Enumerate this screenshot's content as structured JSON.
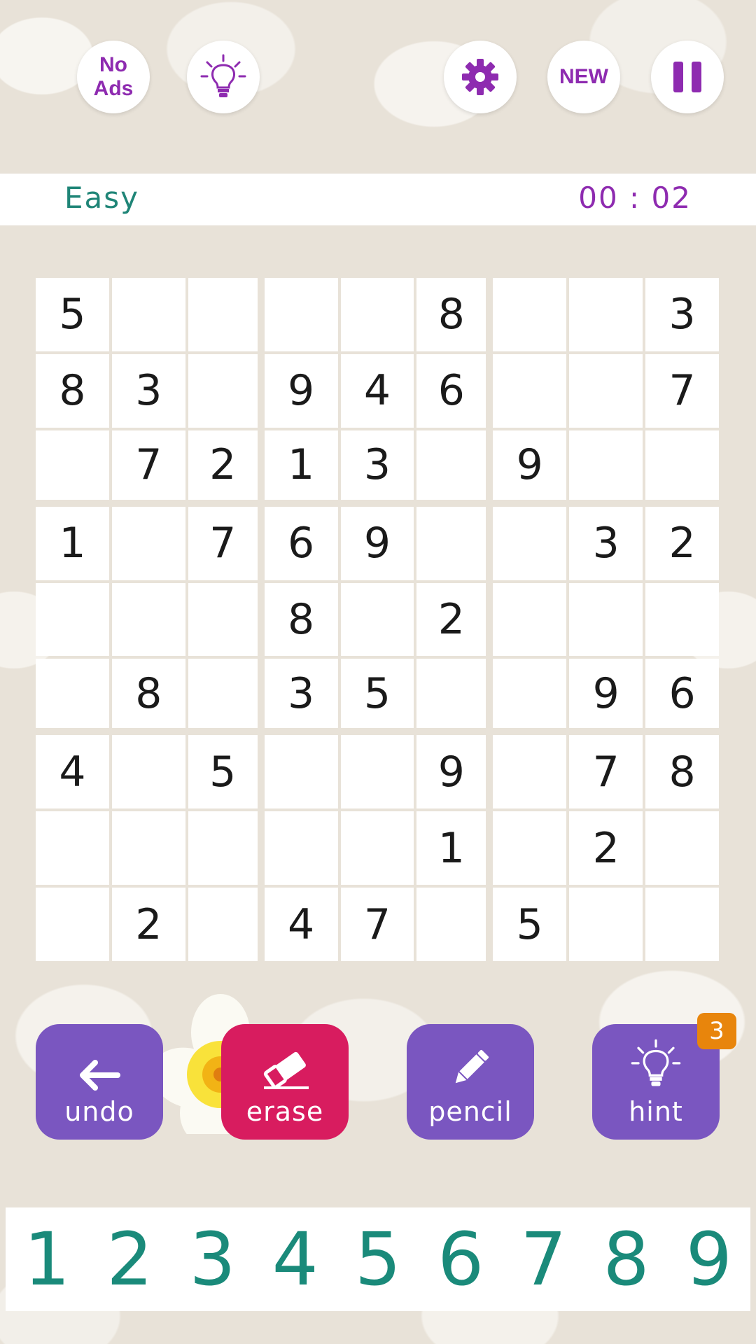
{
  "topbar": {
    "no_ads_line1": "No",
    "no_ads_line2": "Ads",
    "new_label": "NEW",
    "icons": [
      "lightbulb-icon",
      "gear-icon",
      "pause-icon"
    ]
  },
  "status": {
    "difficulty": "Easy",
    "timer": "00 : 02"
  },
  "board": {
    "rows": [
      [
        "5",
        "",
        "",
        "",
        "",
        "8",
        "",
        "",
        "3"
      ],
      [
        "8",
        "3",
        "",
        "9",
        "4",
        "6",
        "",
        "",
        "7"
      ],
      [
        "",
        "7",
        "2",
        "1",
        "3",
        "",
        "9",
        "",
        ""
      ],
      [
        "1",
        "",
        "7",
        "6",
        "9",
        "",
        "",
        "3",
        "2"
      ],
      [
        "",
        "",
        "",
        "8",
        "",
        "2",
        "",
        "",
        ""
      ],
      [
        "",
        "8",
        "",
        "3",
        "5",
        "",
        "",
        "9",
        "6"
      ],
      [
        "4",
        "",
        "5",
        "",
        "",
        "9",
        "",
        "7",
        "8"
      ],
      [
        "",
        "",
        "",
        "",
        "",
        "1",
        "",
        "2",
        ""
      ],
      [
        "",
        "2",
        "",
        "4",
        "7",
        "",
        "5",
        "",
        ""
      ]
    ]
  },
  "actions": {
    "undo": "undo",
    "erase": "erase",
    "pencil": "pencil",
    "hint": "hint",
    "hint_count": "3"
  },
  "numpad": [
    "1",
    "2",
    "3",
    "4",
    "5",
    "6",
    "7",
    "8",
    "9"
  ],
  "colors": {
    "accent_purple": "#8e2bb0",
    "button_purple": "#7a56c0",
    "erase_pink": "#d81c5f",
    "teal": "#1f8577",
    "badge_orange": "#e8850c"
  }
}
